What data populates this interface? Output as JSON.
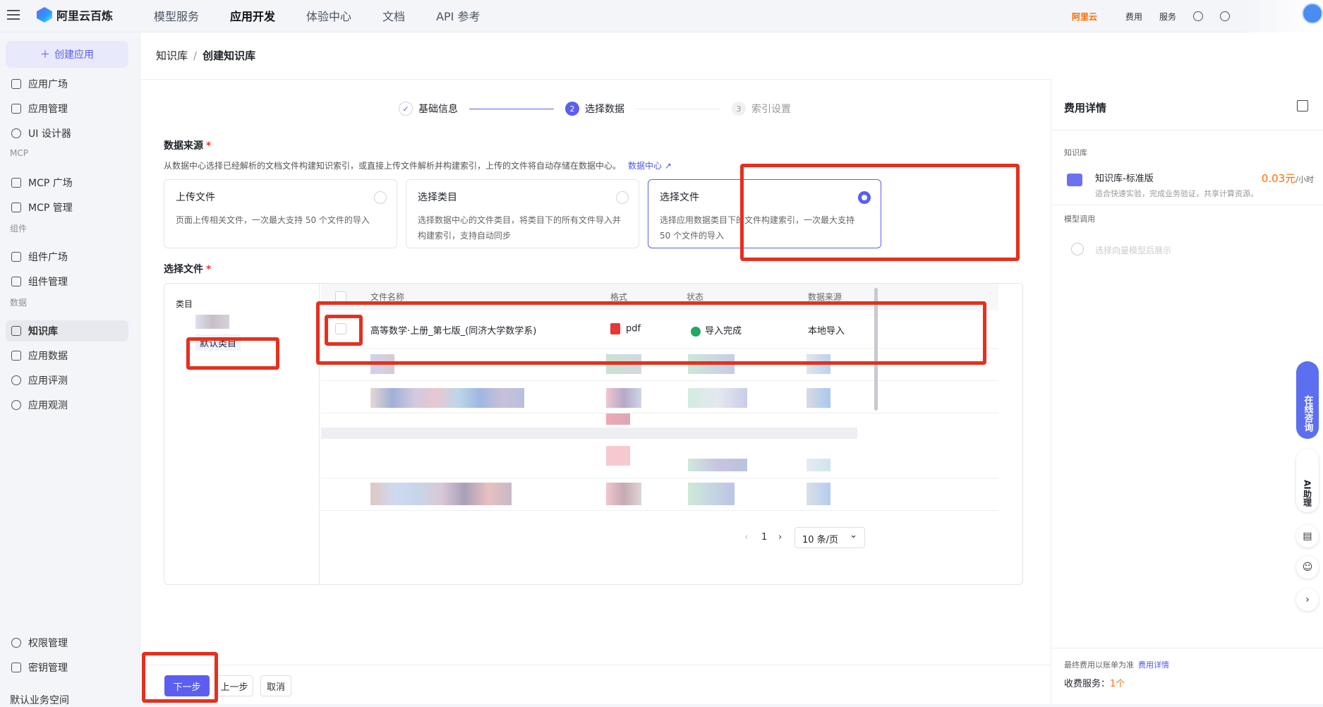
{
  "topbar": {
    "brand": "阿里云百炼",
    "nav": [
      "模型服务",
      "应用开发",
      "体验中心",
      "文档",
      "API 参考"
    ],
    "active_nav": "应用开发",
    "aliyun_logo": "阿里云",
    "links": [
      "费用",
      "服务"
    ]
  },
  "sidebar": {
    "create_label": "创建应用",
    "items": {
      "app_plaza": "应用广场",
      "app_manage": "应用管理",
      "ui_designer": "UI 设计器",
      "mcp_plaza": "MCP 广场",
      "mcp_manage": "MCP 管理",
      "comp_plaza": "组件广场",
      "comp_manage": "组件管理",
      "knowledge": "知识库",
      "app_data": "应用数据",
      "app_eval": "应用评测",
      "app_observe": "应用观测",
      "permission": "权限管理",
      "keys": "密钥管理"
    },
    "groups": {
      "mcp": "MCP",
      "components": "组件",
      "data": "数据"
    },
    "workspace": "默认业务空间"
  },
  "breadcrumb": {
    "parent": "知识库",
    "sep": "/",
    "current": "创建知识库"
  },
  "steps": [
    {
      "num": "✓",
      "label": "基础信息",
      "state": "done"
    },
    {
      "num": "2",
      "label": "选择数据",
      "state": "active"
    },
    {
      "num": "3",
      "label": "索引设置",
      "state": "waiting"
    }
  ],
  "data_source": {
    "label": "数据来源",
    "required_mark": "*",
    "description": "从数据中心选择已经解析的文档文件构建知识索引，或直接上传文件解析并构建索引，上传的文件将自动存储在数据中心。",
    "link": "数据中心 ↗",
    "options": [
      {
        "title": "上传文件",
        "desc": "页面上传相关文件，一次最大支持 50 个文件的导入",
        "selected": false
      },
      {
        "title": "选择类目",
        "desc": "选择数据中心的文件类目，将类目下的所有文件导入并构建索引，支持自动同步",
        "selected": false
      },
      {
        "title": "选择文件",
        "desc": "选择应用数据类目下的文件构建索引，一次最大支持 50 个文件的导入",
        "selected": true
      }
    ]
  },
  "file_select": {
    "label": "选择文件",
    "required_mark": "*",
    "category_header": "类目",
    "category_item": "默认类目",
    "columns": [
      "文件名称",
      "格式",
      "状态",
      "数据来源"
    ],
    "rows": [
      {
        "name": "高等数学·上册_第七版_(同济大学数学系)",
        "format": "pdf",
        "status": "导入完成",
        "source": "本地导入"
      }
    ],
    "pagination": {
      "prev": "‹",
      "page": "1",
      "next": "›",
      "page_size": "10 条/页",
      "chevron": "⌄"
    }
  },
  "buttons": {
    "next": "下一步",
    "prev": "上一步",
    "cancel": "取消"
  },
  "cost": {
    "title": "费用详情",
    "section_kb": "知识库",
    "kb_name": "知识库-标准版",
    "kb_price": "0.03元",
    "kb_unit": "/小时",
    "kb_desc": "适合快速实验，完成业务验证，共享计算资源。",
    "section_model": "模型调用",
    "model_placeholder": "选择向量模型后展示",
    "footer_note": "最终费用以账单为准",
    "footer_link": "费用详情",
    "charge_label": "收费服务：",
    "charge_value": "1个"
  },
  "float": {
    "online": "在线咨询",
    "ai": "AI助理"
  },
  "colors": {
    "primary": "#5b5ef0",
    "highlight": "#e5301e",
    "price": "#ff6a00",
    "success": "#22a861"
  }
}
